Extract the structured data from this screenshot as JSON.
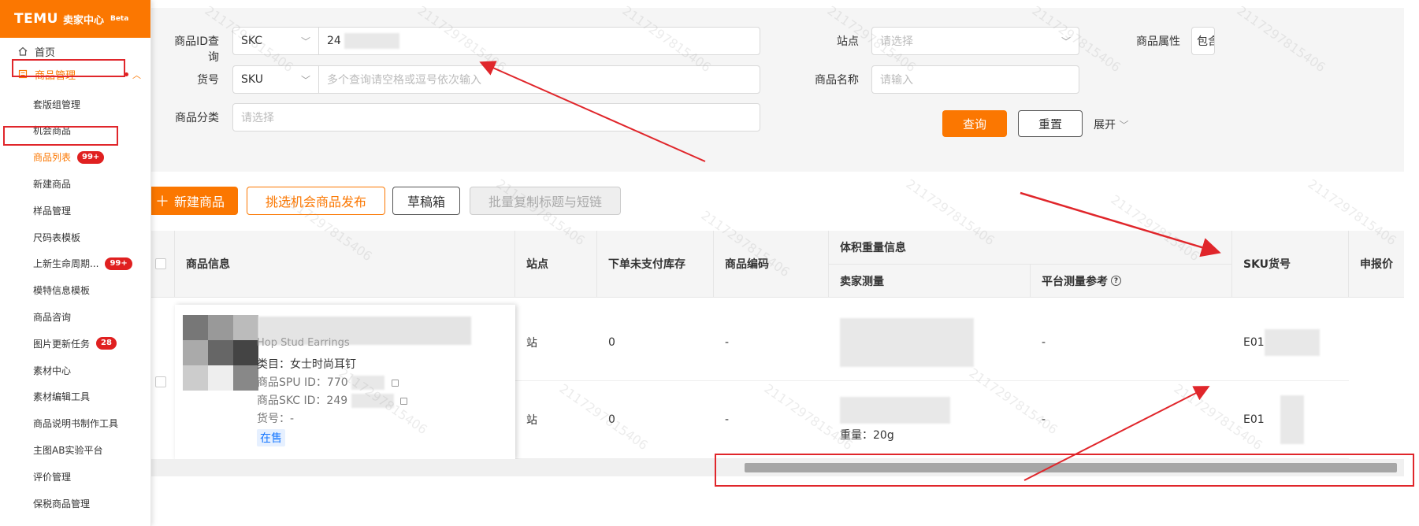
{
  "sidebar": {
    "logo_brand": "TEMU",
    "logo_sub": "卖家中心",
    "logo_beta": "Beta",
    "home": "首页",
    "product_mgmt": "商品管理",
    "items": [
      {
        "label": "套版组管理"
      },
      {
        "label": "机会商品"
      },
      {
        "label": "商品列表",
        "badge": "99+"
      },
      {
        "label": "新建商品"
      },
      {
        "label": "样品管理"
      },
      {
        "label": "尺码表模板"
      },
      {
        "label": "上新生命周期...",
        "badge": "99+"
      },
      {
        "label": "模特信息模板"
      },
      {
        "label": "商品咨询"
      },
      {
        "label": "图片更新任务",
        "badge": "28"
      },
      {
        "label": "素材中心"
      },
      {
        "label": "素材编辑工具"
      },
      {
        "label": "商品说明书制作工具"
      },
      {
        "label": "主图AB实验平台"
      },
      {
        "label": "评价管理"
      },
      {
        "label": "保税商品管理"
      }
    ]
  },
  "filters": {
    "product_id_label": "商品ID查询",
    "product_id_type": "SKC",
    "product_id_value": "24",
    "site_label": "站点",
    "site_placeholder": "请选择",
    "attr_label": "商品属性",
    "attr_value": "包含",
    "sku_label": "货号",
    "sku_type": "SKU",
    "sku_placeholder": "多个查询请空格或逗号依次输入",
    "name_label": "商品名称",
    "name_placeholder": "请输入",
    "category_label": "商品分类",
    "category_placeholder": "请选择",
    "query_btn": "查询",
    "reset_btn": "重置",
    "expand_btn": "展开"
  },
  "actions": {
    "new_product": "新建商品",
    "pick_publish": "挑选机会商品发布",
    "drafts": "草稿箱",
    "batch_copy": "批量复制标题与短链"
  },
  "table": {
    "headers": {
      "product_info": "商品信息",
      "site": "站点",
      "unpaid_stock": "下单未支付库存",
      "product_code": "商品编码",
      "volume_weight": "体积重量信息",
      "seller_measure": "卖家测量",
      "platform_ref": "平台测量参考",
      "sku_code": "SKU货号",
      "declared_price": "申报价"
    },
    "product": {
      "title_fragment": "Hop Stud Earrings",
      "category": "类目：女士时尚耳钉",
      "spu": "商品SPU ID：770",
      "skc": "商品SKC ID：249",
      "sku": "货号：-",
      "status": "在售"
    },
    "rows": [
      {
        "site": "站",
        "unpaid": "0",
        "code": "-",
        "seller": "",
        "platform": "-",
        "sku": "E01"
      },
      {
        "site": "站",
        "unpaid": "0",
        "code": "-",
        "seller": "重量：20g",
        "platform": "-",
        "sku": "E01"
      }
    ]
  },
  "watermark": "2117297815406",
  "colors": {
    "brand": "#fb7701",
    "annotation_red": "#e0262b",
    "badge_red": "#e02020",
    "status_blue": "#1677ff"
  }
}
